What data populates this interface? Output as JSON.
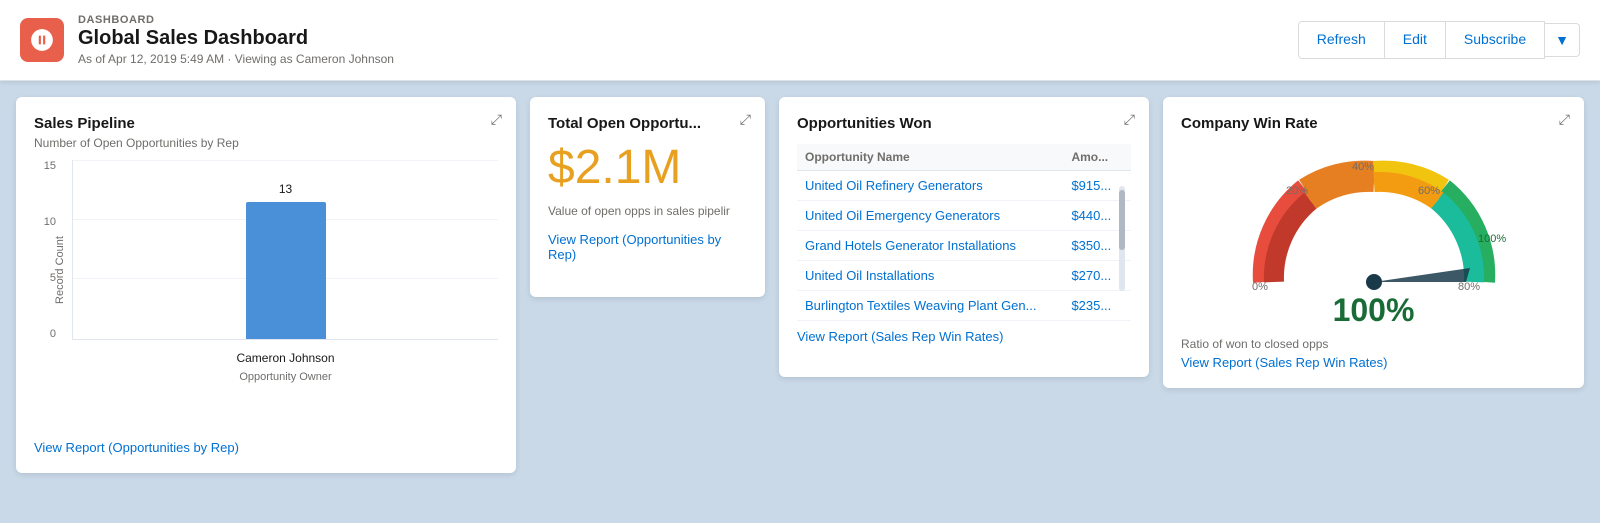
{
  "header": {
    "label": "DASHBOARD",
    "title": "Global Sales Dashboard",
    "subtitle": "As of Apr 12, 2019 5:49 AM · Viewing as Cameron Johnson",
    "refresh_label": "Refresh",
    "edit_label": "Edit",
    "subscribe_label": "Subscribe"
  },
  "pipeline": {
    "title": "Sales Pipeline",
    "subtitle": "Number of Open Opportunities by Rep",
    "y_axis_title": "Record Count",
    "x_axis_title": "Opportunity Owner",
    "bar_value": "13",
    "bar_x_label": "Cameron Johnson",
    "y_labels": [
      "15",
      "10",
      "5",
      "0"
    ],
    "view_report_label": "View Report (Opportunities by Rep)"
  },
  "total_open": {
    "title": "Total Open Opportu...",
    "amount": "$2.1M",
    "description": "Value of open opps in sales pipelir",
    "view_report_label": "View Report (Opportunities by Rep)"
  },
  "opportunities_won": {
    "title": "Opportunities Won",
    "col_name": "Opportunity Name",
    "col_amount": "Amo...",
    "rows": [
      {
        "name": "United Oil Refinery Generators",
        "amount": "$915..."
      },
      {
        "name": "United Oil Emergency Generators",
        "amount": "$440..."
      },
      {
        "name": "Grand Hotels Generator Installations",
        "amount": "$350..."
      },
      {
        "name": "United Oil Installations",
        "amount": "$270..."
      },
      {
        "name": "Burlington Textiles Weaving Plant Gen...",
        "amount": "$235..."
      }
    ],
    "view_report_label": "View Report (Sales Rep Win Rates)"
  },
  "win_rate": {
    "title": "Company Win Rate",
    "value": "100%",
    "description": "Ratio of won to closed opps",
    "view_report_label": "View Report (Sales Rep Win Rates)",
    "gauge_labels": [
      "0%",
      "20%",
      "40%",
      "60%",
      "80%",
      "100%"
    ],
    "needle_angle": 175
  }
}
